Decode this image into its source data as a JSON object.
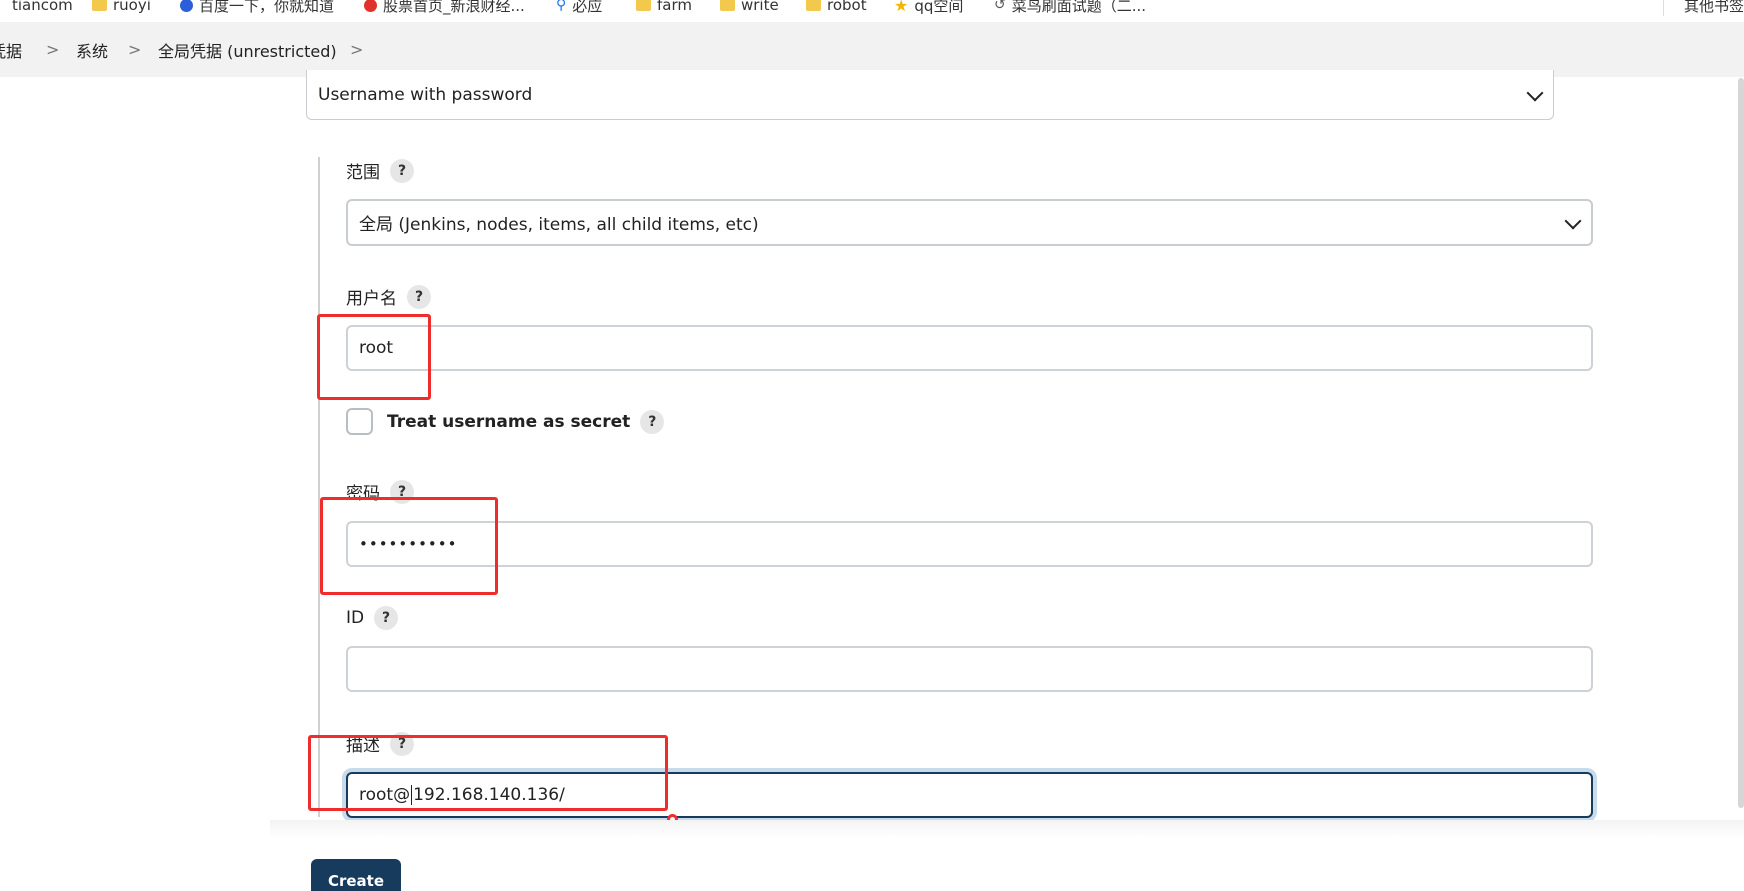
{
  "bookmarks": {
    "items": [
      {
        "label": "tiancom",
        "icon": "globe-icon"
      },
      {
        "label": "ruoyi",
        "icon": "folder-icon"
      },
      {
        "label": "百度一下，你就知道",
        "icon": "baidu-paw-icon"
      },
      {
        "label": "股票首页_新浪财经...",
        "icon": "weibo-icon"
      },
      {
        "label": "必应",
        "icon": "bing-icon"
      },
      {
        "label": "farm",
        "icon": "folder-icon"
      },
      {
        "label": "write",
        "icon": "folder-icon"
      },
      {
        "label": "robot",
        "icon": "folder-icon"
      },
      {
        "label": "qq空间",
        "icon": "star-icon"
      },
      {
        "label": "菜鸟刷面试题（二...",
        "icon": "link-icon"
      }
    ],
    "other_label": "其他书签"
  },
  "breadcrumb": {
    "items": [
      "凭据",
      "系统",
      "全局凭据 (unrestricted)"
    ]
  },
  "form": {
    "kind_value": "Username with password",
    "scope_label": "范围",
    "scope_value": "全局 (Jenkins, nodes, items, all child items, etc)",
    "username_label": "用户名",
    "username_value": "root",
    "treat_secret_label": "Treat username as secret",
    "treat_secret_checked": false,
    "password_label": "密码",
    "password_value": "••••••••••",
    "id_label": "ID",
    "id_value": "",
    "description_label": "描述",
    "description_before_caret": "root@",
    "description_after_caret": "192.168.140.136/",
    "help_symbol": "?",
    "create_label": "Create"
  },
  "colors": {
    "accent": "#163b5c",
    "annotation": "#f02d2d",
    "breadcrumb_bg": "#f2f2f2"
  }
}
